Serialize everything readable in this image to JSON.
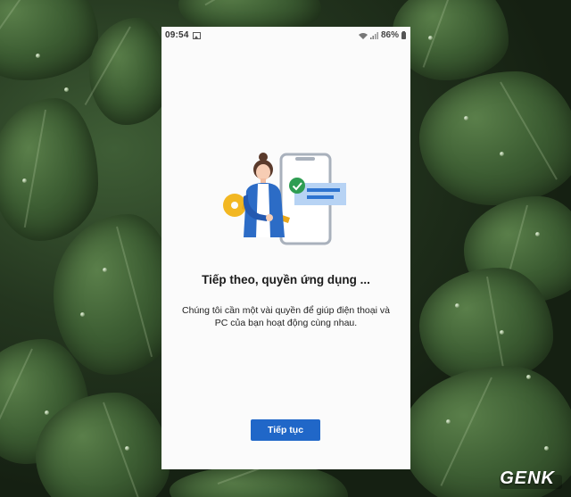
{
  "status_bar": {
    "time": "09:54",
    "image_icon": "image-icon",
    "wifi_icon": "wifi-icon",
    "signal_icon": "signal-icon",
    "battery_percent": "86%",
    "battery_icon": "battery-icon"
  },
  "main": {
    "illustration": "permissions-illustration",
    "title": "Tiếp theo, quyền ứng dụng ...",
    "description": "Chúng tôi cần một vài quyền để giúp điện thoại và PC của bạn hoạt động cùng nhau.",
    "continue_label": "Tiếp tục"
  },
  "watermark": {
    "text": "GENK"
  },
  "colors": {
    "button": "#2067c8",
    "panel": "#fbfbfb",
    "check": "#2e9d52",
    "key": "#f2b722",
    "jacket": "#2c6cc6"
  }
}
